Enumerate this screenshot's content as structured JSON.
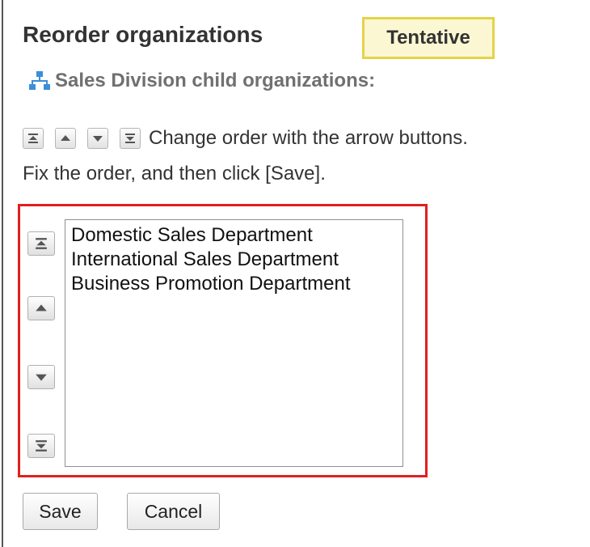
{
  "header": {
    "title": "Reorder organizations",
    "badge": "Tentative"
  },
  "subtitle": {
    "icon": "org-chart-icon",
    "text": "Sales Division child organizations:"
  },
  "instructions": {
    "line1": "Change order with the arrow buttons.",
    "line2": "Fix the order, and then click [Save].",
    "icons": [
      "move-top-icon",
      "move-up-icon",
      "move-down-icon",
      "move-bottom-icon"
    ]
  },
  "order_list": {
    "options": [
      "Domestic Sales Department",
      "International Sales Department",
      "Business Promotion Department"
    ],
    "controls": [
      "move-top",
      "move-up",
      "move-down",
      "move-bottom"
    ]
  },
  "actions": {
    "save_label": "Save",
    "cancel_label": "Cancel"
  },
  "colors": {
    "badge_border": "#e6d24a",
    "badge_background": "#fbf7d2",
    "highlight_border": "#e02020",
    "org_icon": "#3a8fd8",
    "subtitle_text": "#707070"
  }
}
